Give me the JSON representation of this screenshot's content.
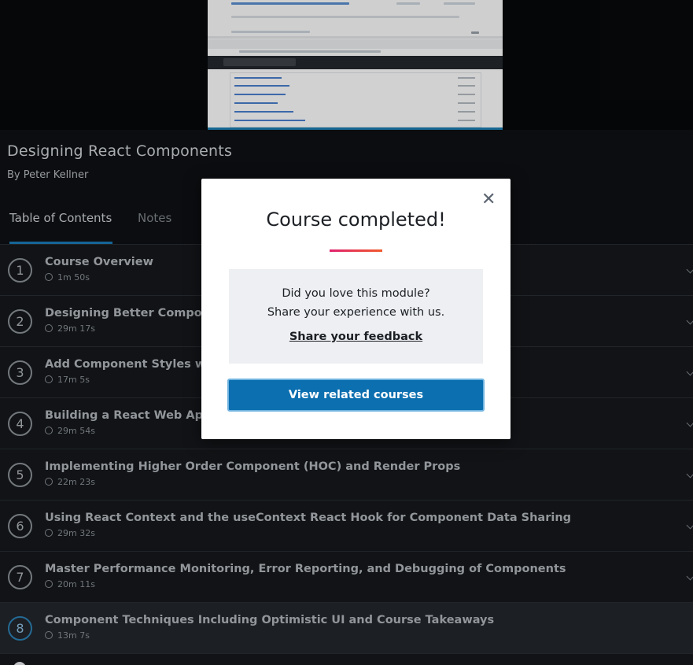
{
  "course": {
    "title": "Designing React Components",
    "author": "By Peter Kellner"
  },
  "tabs": {
    "toc_label": "Table of Contents",
    "notes_label": "Notes"
  },
  "modules": [
    {
      "number": "1",
      "title": "Course Overview",
      "duration": "1m 50s"
    },
    {
      "number": "2",
      "title": "Designing Better Compone",
      "duration": "29m 17s"
    },
    {
      "number": "3",
      "title": "Add Component Styles wit",
      "duration": "17m 5s"
    },
    {
      "number": "4",
      "title": "Building a React Web App",
      "duration": "29m 54s"
    },
    {
      "number": "5",
      "title": "Implementing Higher Order Component (HOC) and Render Props",
      "duration": "22m 23s"
    },
    {
      "number": "6",
      "title": "Using React Context and the useContext React Hook for Component Data Sharing",
      "duration": "29m 32s"
    },
    {
      "number": "7",
      "title": "Master Performance Monitoring, Error Reporting, and Debugging of Components",
      "duration": "20m 11s"
    },
    {
      "number": "8",
      "title": "Component Techniques Including Optimistic UI and Course Takeaways",
      "duration": "13m 7s"
    }
  ],
  "modal": {
    "title": "Course completed!",
    "feedback_line1": "Did you love this module?",
    "feedback_line2": "Share your experience with us.",
    "feedback_link": "Share your feedback",
    "related_button": "View related courses",
    "close_icon": "close-icon"
  },
  "colors": {
    "accent_blue": "#0c6fb0",
    "tab_underline": "#1b7cb8",
    "gradient_start": "#e0216f",
    "gradient_end": "#f05a2c"
  }
}
